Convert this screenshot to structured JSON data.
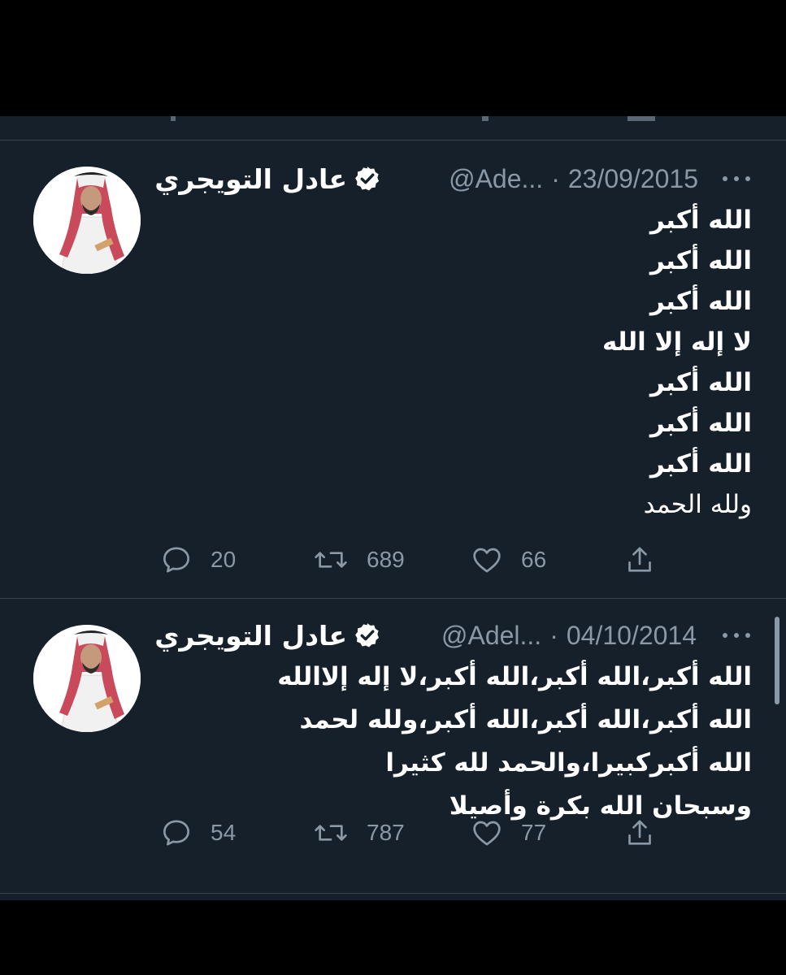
{
  "colors": {
    "background": "#15202b",
    "text": "#ffffff",
    "secondary": "#8b98a5",
    "divider": "#38444d"
  },
  "tweets": [
    {
      "name": "عادل التويجري",
      "handle": "@Ade...",
      "dot": "·",
      "date": "23/09/2015",
      "lines": [
        "الله أكبر",
        "الله أكبر",
        "الله أكبر",
        "لا إله إلا الله",
        "الله أكبر",
        "الله أكبر",
        "الله أكبر",
        "ولله الحمد"
      ],
      "replies": "20",
      "retweets": "689",
      "likes": "66"
    },
    {
      "name": "عادل التويجري",
      "handle": "@Adel...",
      "dot": "·",
      "date": "04/10/2014",
      "lines": [
        "الله أكبر،الله أكبر،الله أكبر،لا إله إلاالله",
        "الله أكبر،الله أكبر،الله أكبر،ولله لحمد",
        "الله أكبركبيرا،والحمد لله كثيرا",
        "وسبحان الله بكرة وأصيلا"
      ],
      "replies": "54",
      "retweets": "787",
      "likes": "77"
    }
  ],
  "icons": {
    "reply": "reply-icon",
    "retweet": "retweet-icon",
    "like": "heart-icon",
    "share": "share-icon",
    "verified": "verified-badge-icon",
    "more": "more-options-icon"
  }
}
